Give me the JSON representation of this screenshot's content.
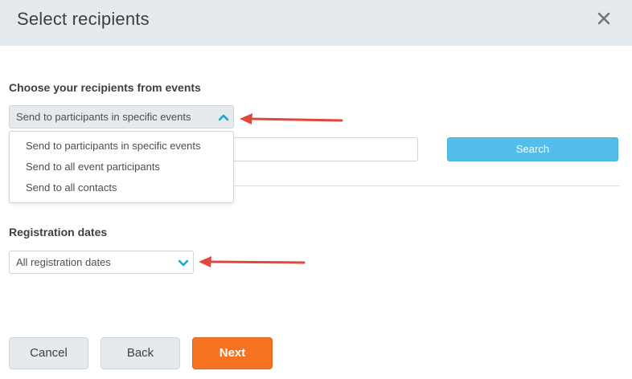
{
  "dialog": {
    "title": "Select recipients"
  },
  "recipients": {
    "section_title": "Choose your recipients from events",
    "selected": "Send to participants in specific events",
    "options": [
      "Send to participants in specific events",
      "Send to all event participants",
      "Send to all contacts"
    ],
    "expanded": true
  },
  "search": {
    "input_value": "",
    "button_label": "Search"
  },
  "registration_dates": {
    "section_title": "Registration dates",
    "selected": "All registration dates"
  },
  "footer": {
    "cancel_label": "Cancel",
    "back_label": "Back",
    "next_label": "Next"
  },
  "icons": {
    "close": "close-icon",
    "chevron_up": "chevron-up-icon",
    "chevron_down": "chevron-down-icon",
    "annotation_arrow": "arrow-left-icon"
  },
  "colors": {
    "header_bg": "#e4eaee",
    "accent_blue": "#55bde9",
    "chevron_blue": "#1ba5d8",
    "next_orange": "#f47321",
    "annotation_red": "#e0483e"
  }
}
